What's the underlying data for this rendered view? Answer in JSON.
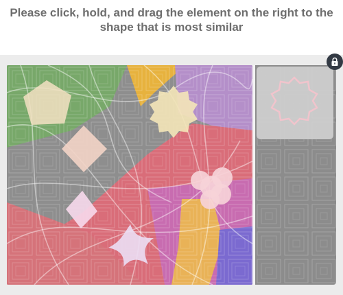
{
  "instruction": {
    "line1": "Please click, hold, and drag the element on the right to the",
    "line2": "shape that is most similar"
  },
  "puzzle": {
    "target_shapes": [
      "pentagon",
      "sun-badge",
      "diamond",
      "cloud-flower",
      "rhombus",
      "star-cross"
    ],
    "draggable_shape": "sun-badge-outline"
  },
  "icons": {
    "lock": "lock-icon"
  },
  "colors": {
    "instruction_text": "#6e6e6e",
    "panel_bg": "#ececec",
    "tray_bg": "#8c8c8c",
    "lock_bg": "#333a44"
  }
}
